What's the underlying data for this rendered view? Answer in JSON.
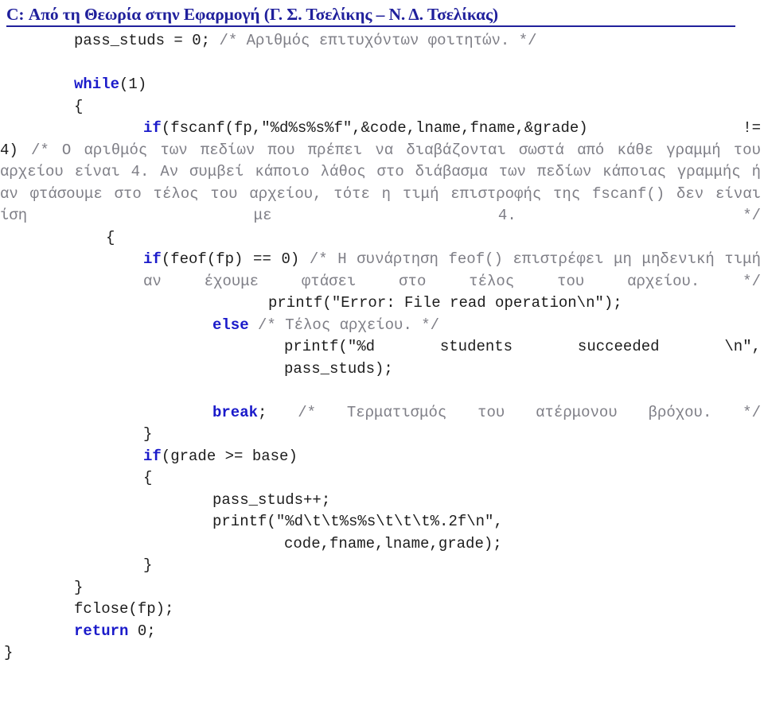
{
  "header": {
    "title": "C: Από τη Θεωρία στην Εφαρμογή (Γ. Σ. Τσελίκης – Ν. Δ. Τσελίκας)",
    "color": "#20209c"
  },
  "colors": {
    "keyword": "#1a1aca",
    "comment": "#7e7e86",
    "code": "#1c1c1c",
    "background": "#ffffff",
    "header_rule": "#20209c"
  },
  "code": {
    "language": "C",
    "lines": [
      {
        "id": "line-pass-studs-init",
        "indent": 93,
        "segments": [
          {
            "kind": "plain",
            "text": "pass_studs = 0; "
          },
          {
            "kind": "comment",
            "text": "/* Αριθμός επιτυχόντων φοιτητών. */"
          }
        ]
      },
      {
        "id": "line-blank-1",
        "blank": true
      },
      {
        "id": "line-while",
        "indent": 93,
        "segments": [
          {
            "kind": "keyword",
            "text": "while"
          },
          {
            "kind": "plain",
            "text": "(1)"
          }
        ]
      },
      {
        "id": "line-while-open-brace",
        "indent": 93,
        "segments": [
          {
            "kind": "plain",
            "text": "{"
          }
        ]
      },
      {
        "id": "line-if-fscanf",
        "indent": 180,
        "justified": true,
        "segments": [
          {
            "kind": "keyword",
            "text": "if"
          },
          {
            "kind": "plain",
            "text": "(fscanf(fp,\"%d%s%s%f\",&code,lname,fname,&grade) !="
          }
        ]
      },
      {
        "id": "line-fscanf-comment-wrap",
        "indent": 0,
        "justified": true,
        "segments": [
          {
            "kind": "plain",
            "text": "4) "
          },
          {
            "kind": "comment",
            "text": "/* Ο αριθμός των πεδίων που πρέπει να διαβάζονται σωστά από κάθε γραμμή του αρχείου είναι 4. Αν συμβεί κάποιο λάθος στο διάβασμα των πεδίων κάποιας γραμμής ή αν φτάσουμε στο τέλος του αρχείου, τότε η τιμή επιστροφής της fscanf() δεν είναι ίση με 4. */"
          }
        ]
      },
      {
        "id": "line-inner-open-brace",
        "indent": 133,
        "segments": [
          {
            "kind": "plain",
            "text": "{"
          }
        ]
      },
      {
        "id": "line-if-feof",
        "indent": 180,
        "justified": true,
        "segments": [
          {
            "kind": "keyword",
            "text": "if"
          },
          {
            "kind": "plain",
            "text": "(feof(fp) == 0) "
          },
          {
            "kind": "comment",
            "text": "/* Η συνάρτηση feof() επιστρέφει μη μηδενική τιμή αν έχουμε φτάσει στο τέλος του αρχείου. */"
          }
        ]
      },
      {
        "id": "line-printf-error",
        "indent": 337,
        "segments": [
          {
            "kind": "plain",
            "text": "printf(\"Error: File read operation\\n\");"
          }
        ]
      },
      {
        "id": "line-else",
        "indent": 267,
        "segments": [
          {
            "kind": "keyword",
            "text": "else"
          },
          {
            "kind": "plain",
            "text": " "
          },
          {
            "kind": "comment",
            "text": "/* Τέλος αρχείου. */"
          }
        ]
      },
      {
        "id": "line-printf-succeeded",
        "indent": 357,
        "justified": true,
        "segments": [
          {
            "kind": "plain",
            "text": "printf(\"%d students succeeded \\n\","
          }
        ]
      },
      {
        "id": "line-pass-studs-arg",
        "indent": 357,
        "segments": [
          {
            "kind": "plain",
            "text": "pass_studs);"
          }
        ]
      },
      {
        "id": "line-blank-2",
        "blank": true
      },
      {
        "id": "line-break",
        "indent": 267,
        "justified": true,
        "segments": [
          {
            "kind": "keyword",
            "text": "break"
          },
          {
            "kind": "plain",
            "text": "; "
          },
          {
            "kind": "comment",
            "text": "/* Τερματισμός του ατέρμονου βρόχου. */"
          }
        ]
      },
      {
        "id": "line-inner-close-brace",
        "indent": 180,
        "segments": [
          {
            "kind": "plain",
            "text": "}"
          }
        ]
      },
      {
        "id": "line-if-grade",
        "indent": 180,
        "segments": [
          {
            "kind": "keyword",
            "text": "if"
          },
          {
            "kind": "plain",
            "text": "(grade >= base)"
          }
        ]
      },
      {
        "id": "line-grade-open-brace",
        "indent": 180,
        "segments": [
          {
            "kind": "plain",
            "text": "{"
          }
        ]
      },
      {
        "id": "line-pass-studs-inc",
        "indent": 267,
        "segments": [
          {
            "kind": "plain",
            "text": "pass_studs++;"
          }
        ]
      },
      {
        "id": "line-printf-record",
        "indent": 267,
        "segments": [
          {
            "kind": "plain",
            "text": "printf(\"%d\\t\\t%s%s\\t\\t\\t%.2f\\n\","
          }
        ]
      },
      {
        "id": "line-printf-record-args",
        "indent": 357,
        "segments": [
          {
            "kind": "plain",
            "text": "code,fname,lname,grade);"
          }
        ]
      },
      {
        "id": "line-grade-close-brace",
        "indent": 180,
        "segments": [
          {
            "kind": "plain",
            "text": "}"
          }
        ]
      },
      {
        "id": "line-while-close-brace",
        "indent": 93,
        "segments": [
          {
            "kind": "plain",
            "text": "}"
          }
        ]
      },
      {
        "id": "line-fclose",
        "indent": 93,
        "segments": [
          {
            "kind": "plain",
            "text": "fclose(fp);"
          }
        ]
      },
      {
        "id": "line-return",
        "indent": 93,
        "segments": [
          {
            "kind": "keyword",
            "text": "return"
          },
          {
            "kind": "plain",
            "text": " 0;"
          }
        ]
      },
      {
        "id": "line-function-close-brace",
        "indent": 5,
        "segments": [
          {
            "kind": "plain",
            "text": "}"
          }
        ]
      }
    ]
  }
}
